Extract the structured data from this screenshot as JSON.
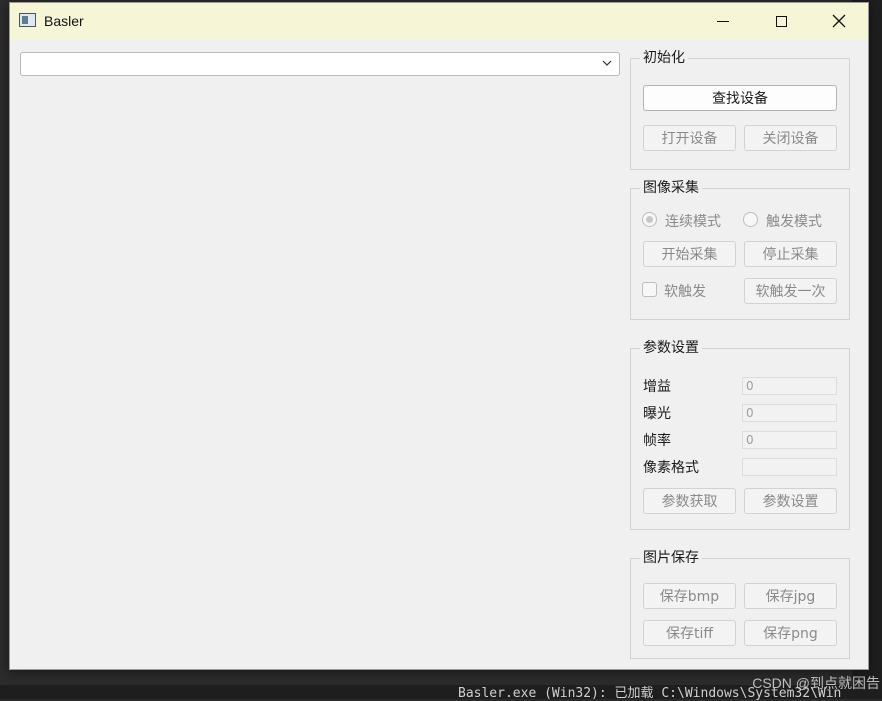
{
  "window": {
    "title": "Basler"
  },
  "device_combo": {
    "value": ""
  },
  "init_group": {
    "title": "初始化",
    "find_device": "查找设备",
    "open_device": "打开设备",
    "close_device": "关闭设备"
  },
  "capture_group": {
    "title": "图像采集",
    "continuous_mode": "连续模式",
    "trigger_mode": "触发模式",
    "start_capture": "开始采集",
    "stop_capture": "停止采集",
    "soft_trigger": "软触发",
    "soft_trigger_once": "软触发一次"
  },
  "params_group": {
    "title": "参数设置",
    "gain_label": "增益",
    "gain_value": "0",
    "exposure_label": "曝光",
    "exposure_value": "0",
    "framerate_label": "帧率",
    "framerate_value": "0",
    "pixel_format_label": "像素格式",
    "pixel_format_value": "",
    "get_params": "参数获取",
    "set_params": "参数设置"
  },
  "save_group": {
    "title": "图片保存",
    "save_bmp": "保存bmp",
    "save_jpg": "保存jpg",
    "save_tiff": "保存tiff",
    "save_png": "保存png"
  },
  "background": {
    "status_line": "Basler.exe  (Win32): 已加载  C:\\Windows\\System32\\Win",
    "watermark": "CSDN @到点就困告"
  }
}
